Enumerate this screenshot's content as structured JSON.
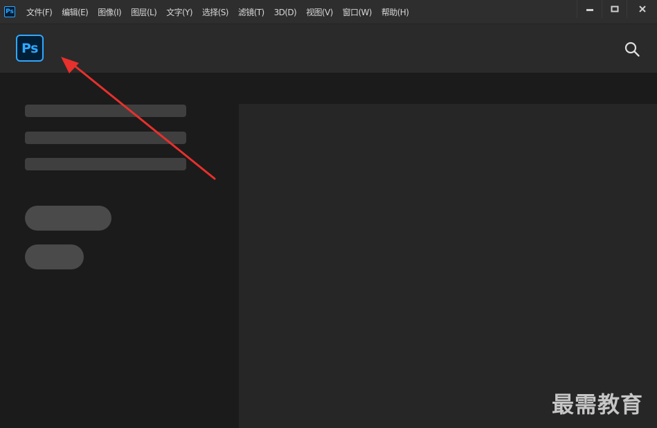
{
  "menubar": {
    "app_icon_text": "Ps",
    "items": [
      {
        "label": "文件(F)"
      },
      {
        "label": "编辑(E)"
      },
      {
        "label": "图像(I)"
      },
      {
        "label": "图层(L)"
      },
      {
        "label": "文字(Y)"
      },
      {
        "label": "选择(S)"
      },
      {
        "label": "滤镜(T)"
      },
      {
        "label": "3D(D)"
      },
      {
        "label": "视图(V)"
      },
      {
        "label": "窗口(W)"
      },
      {
        "label": "帮助(H)"
      }
    ],
    "window_controls": [
      "minimize-icon",
      "restore-icon",
      "close-icon"
    ]
  },
  "topbar": {
    "logo_text": "Ps",
    "search_icon": "search-icon"
  },
  "colors": {
    "ps_blue": "#31a8ff",
    "ps_dark": "#001e36",
    "annotation_red": "#e8302c"
  },
  "watermark": "最需教育"
}
